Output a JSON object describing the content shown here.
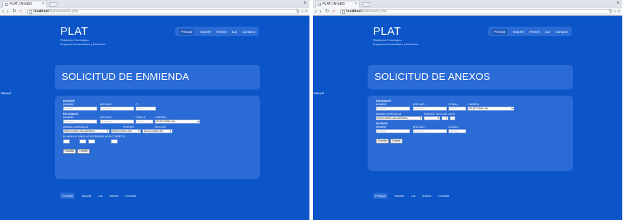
{
  "colors": {
    "page_bg": "#0c55c8",
    "panel_bg": "#2a6bd6",
    "text": "#ffffff"
  },
  "left": {
    "tab_title": "PLAT | AHoEG",
    "url_host": "localhost",
    "url_path": "/plat/enmienda.php",
    "brand": {
      "title": "PLAT",
      "sub1": "Plataforma Tecnológica",
      "sub2": "Programa Humanidades y Educación"
    },
    "nav": [
      "Principal",
      "Soporte",
      "Anexos",
      "Luz",
      "Contacto"
    ],
    "sidebar_link": "Manual",
    "heading": "SOLICITUD DE ENMIENDA",
    "form": {
      "docente_section": "DOCENTE",
      "docente_labels": [
        "NOMBRE",
        "APELLIDO",
        "C.I."
      ],
      "docente_placeholders": [
        "NOMBRE",
        "APELLIDO",
        "CEDULA"
      ],
      "estudiante_section": "ESTUDIANTE",
      "estudiante_labels": [
        "NOMBRE",
        "APELLIDO",
        "CEDULA",
        "CARRERA"
      ],
      "estudiante_placeholders": [
        "NOMBRE",
        "APELLIDO",
        "CEDULA"
      ],
      "carrera_select": "SELECCIONE UNA",
      "uc_labels": [
        "UNIDAD CURRICULAR",
        "PERIODO",
        "SECCION"
      ],
      "uc_select": "SELECCIONE UNA CARRERA",
      "periodo_select": "SELECCIONE UNO",
      "seccion_select": "SELECCIONE UNO",
      "planilla_label": "PLANILLA N° LINEA NOTA ERRONEA NOTA CORRECTA",
      "buttons": [
        "Guardar",
        "Limpiar"
      ]
    },
    "footer_nav": [
      "Principal",
      "Soporte",
      "Luz",
      "Anexos",
      "Contacto"
    ]
  },
  "right": {
    "tab_title": "PLAT | AHoEG",
    "url_host": "localhost",
    "url_path": "/plat/anexos.php",
    "brand": {
      "title": "PLAT",
      "sub1": "Plataforma Tecnológica",
      "sub2": "Programa Humanidades y Educación"
    },
    "nav": [
      "Principal",
      "Soporte",
      "Anexos",
      "Luz",
      "Contacto"
    ],
    "sidebar_link": "Manual",
    "heading": "SOLICITUD DE ANEXOS",
    "form": {
      "estudiante_section": "ESTUDIANTE",
      "estudiante_labels": [
        "NOMBRE",
        "APELLIDO",
        "CEDULA",
        "CARRERA"
      ],
      "estudiante_placeholders": [
        "NOMBRE",
        "APELLIDO",
        "CEDULA"
      ],
      "carrera_select": "SELECCIONE UNA",
      "uc_labels": [
        "UNIDAD CURRICULAR",
        "PERIODO",
        "SECCION",
        "NOTA"
      ],
      "uc_select": "SELECCIONE UNA CARRERA",
      "docente_section": "DOCENTE",
      "docente_labels": [
        "NOMBRE",
        "APELLIDO",
        "CEDULA"
      ],
      "docente_placeholders": [
        "NOMBRE",
        "APELLIDO",
        "CEDULA"
      ],
      "buttons": [
        "Guardar",
        "Limpiar"
      ]
    },
    "footer_nav": [
      "Principal",
      "Soporte",
      "Luz",
      "Anexos",
      "Contacto"
    ]
  }
}
